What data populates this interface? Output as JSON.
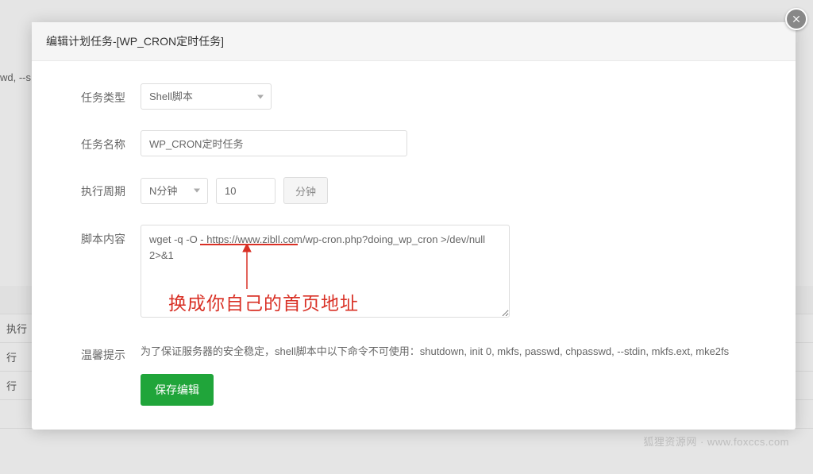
{
  "background": {
    "partial_text": "wd, --s",
    "rows": [
      "执行",
      "行",
      "行"
    ]
  },
  "modal": {
    "title": "编辑计划任务-[WP_CRON定时任务]",
    "fields": {
      "task_type": {
        "label": "任务类型",
        "value": "Shell脚本"
      },
      "task_name": {
        "label": "任务名称",
        "value": "WP_CRON定时任务"
      },
      "period": {
        "label": "执行周期",
        "unit_select": "N分钟",
        "value": "10",
        "unit_suffix": "分钟"
      },
      "script": {
        "label": "脚本内容",
        "value": "wget -q -O - https://www.zibll.com/wp-cron.php?doing_wp_cron >/dev/null 2>&1"
      },
      "hint": {
        "label": "温馨提示",
        "text": "为了保证服务器的安全稳定，shell脚本中以下命令不可使用：shutdown, init 0, mkfs, passwd, chpasswd, --stdin, mkfs.ext, mke2fs"
      }
    },
    "annotation": "换成你自己的首页地址",
    "save_button": "保存编辑"
  },
  "watermark": "狐狸资源网 · www.foxccs.com"
}
